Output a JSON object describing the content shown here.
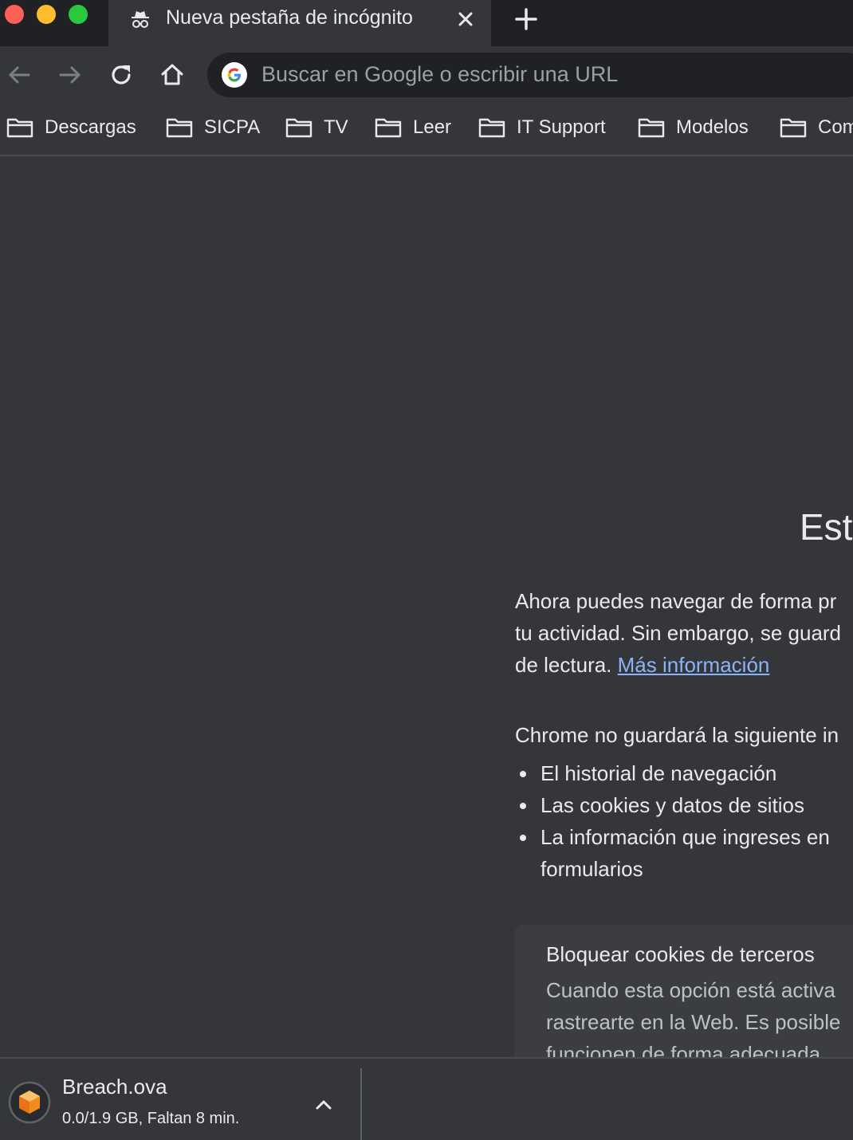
{
  "tab": {
    "title": "Nueva pestaña de incógnito"
  },
  "omnibox": {
    "placeholder": "Buscar en Google o escribir una URL"
  },
  "bookmarks": [
    {
      "label": "Descargas"
    },
    {
      "label": "SICPA"
    },
    {
      "label": "TV"
    },
    {
      "label": "Leer"
    },
    {
      "label": "IT Support"
    },
    {
      "label": "Modelos"
    },
    {
      "label": "Com"
    }
  ],
  "content": {
    "heading": "Esta",
    "intro_line1": "Ahora puedes navegar de forma pr",
    "intro_line2": "tu actividad. Sin embargo, se guard",
    "intro_line3_prefix": "de lectura. ",
    "intro_link": "Más información",
    "not_saved_title": "Chrome no guardará la siguiente in",
    "not_saved_items": [
      "El historial de navegación",
      "Las cookies y datos de sitios",
      "La información que ingreses en",
      "formularios"
    ],
    "card_title": "Bloquear cookies de terceros",
    "card_line1": "Cuando esta opción está activa",
    "card_line2": "rastrearte en la Web. Es posible",
    "card_line3": "funcionen de forma adecuada"
  },
  "download": {
    "filename": "Breach.ova",
    "status": "0.0/1.9 GB, Faltan 8 min."
  },
  "colors": {
    "background": "#35363a",
    "tabstrip": "#202124",
    "link": "#8ab4f8",
    "text": "#e8eaed"
  },
  "icons": [
    "incognito-icon",
    "close-icon",
    "plus-icon",
    "back-arrow-icon",
    "forward-arrow-icon",
    "reload-icon",
    "home-icon",
    "google-icon",
    "folder-icon",
    "virtualbox-icon",
    "chevron-up-icon"
  ]
}
